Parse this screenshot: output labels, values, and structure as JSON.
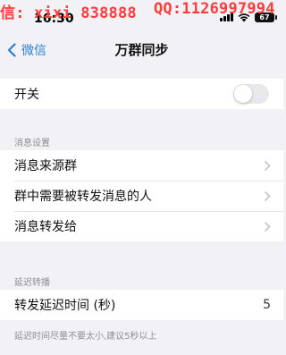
{
  "watermark": {
    "left": "信: xixi_838888",
    "right": "QQ:1126997994"
  },
  "status": {
    "time": "16:30",
    "battery": "67"
  },
  "nav": {
    "back_label": "微信",
    "title": "万群同步"
  },
  "switch_row": {
    "label": "开关",
    "on": false
  },
  "message_settings": {
    "header": "消息设置",
    "items": [
      {
        "label": "消息来源群"
      },
      {
        "label": "群中需要被转发消息的人"
      },
      {
        "label": "消息转发给"
      }
    ]
  },
  "delay": {
    "header": "延迟转播",
    "row_label": "转发延迟时间 (秒)",
    "row_value": "5",
    "footnote": "延迟时间尽量不要太小,建议5秒以上"
  }
}
